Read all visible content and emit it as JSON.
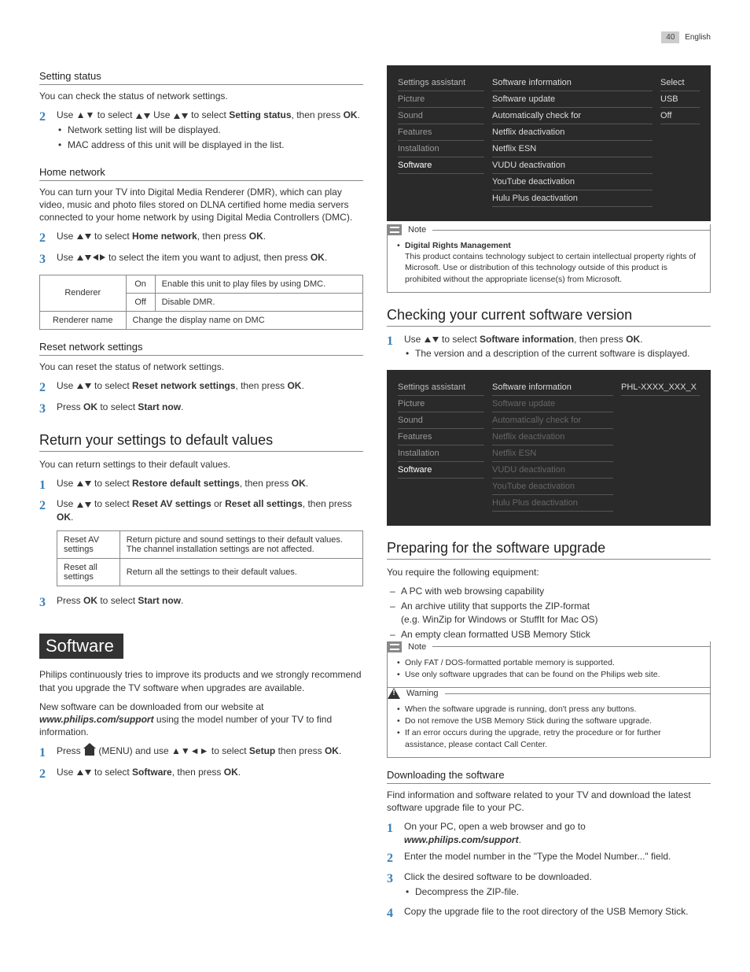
{
  "page": {
    "number": "40",
    "lang": "English"
  },
  "col_left": {
    "setting_status": {
      "h": "Setting status",
      "p": "You can check the status of network settings.",
      "step2": "Use ▲▼ to select ",
      "step2_bold": "Setting status",
      "step2_tail": ", then press ",
      "ok": "OK",
      "step2_end": ".",
      "bul1": "Network setting list will be displayed.",
      "bul2": "MAC address of this unit will be displayed in the list."
    },
    "home_network": {
      "h": "Home network",
      "p": "You can turn your TV into Digital Media Renderer (DMR), which can play video, music and photo files stored on DLNA certified home media servers connected to your home network by using Digital Media Controllers (DMC).",
      "s2a": "Use ▲▼ to select ",
      "s2b": "Home network",
      "s2c": ", then press ",
      "s3a": "Use ▲▼◄► to select the item you want to adjust, then press ",
      "table": {
        "r1c1": "Renderer",
        "r1c2": "On",
        "r1c3": "Enable this unit to play files by using DMC.",
        "r2c2": "Off",
        "r2c3": "Disable DMR.",
        "r3c1": "Renderer name",
        "r3c2": "Change the display name on DMC"
      }
    },
    "reset_net": {
      "h": "Reset network settings",
      "p": "You can reset the status of network settings.",
      "s2a": "Use ▲▼ to select ",
      "s2b": "Reset network settings",
      "s2c": ", then press ",
      "s3a": "Press ",
      "s3b": " to select ",
      "s3c": "Start now",
      "s3d": "."
    },
    "return_default": {
      "h": "Return your settings to default values",
      "p": "You can return settings to their default values.",
      "s1a": "Use ▲▼ to select ",
      "s1b": "Restore default settings",
      "s1c": ", then press ",
      "s2a": "Use ▲▼ to select ",
      "s2b": "Reset AV settings",
      "s2c": " or ",
      "s2d": "Reset all settings",
      "s2e": ", then press ",
      "table": {
        "r1c1": "Reset AV settings",
        "r1c2": "Return picture and sound settings to their default values. The channel installation settings are not affected.",
        "r2c1": "Reset all settings",
        "r2c2": "Return all the settings to their default values."
      },
      "s3a": "Press ",
      "s3b": " to select ",
      "s3c": "Start now",
      "s3d": "."
    },
    "software": {
      "h": "Software",
      "p1": "Philips continuously tries to improve its products and we strongly recommend that you upgrade the TV software when upgrades are available.",
      "p2a": "New software can be downloaded from our website at ",
      "p2b": "www.philips.com/support",
      "p2c": " using the model number of your TV to find information.",
      "s1a": "Press ",
      "s1b": " (MENU) and use ▲▼◄► to select ",
      "s1c": "Setup",
      "s1d": " then press ",
      "s2a": "Use ▲▼ to select ",
      "s2b": "Software",
      "s2c": ", then press "
    }
  },
  "col_right": {
    "ui1": {
      "c1": [
        "Settings assistant",
        "Picture",
        "Sound",
        "Features",
        "Installation",
        "Software"
      ],
      "c2": [
        "Software information",
        "Software update",
        "Automatically check for",
        "Netflix deactivation",
        "Netflix ESN",
        "VUDU deactivation",
        "YouTube deactivation",
        "Hulu Plus deactivation"
      ],
      "c3": [
        "Select",
        "USB",
        "Off"
      ]
    },
    "note1": {
      "title": "Note",
      "b1": "Digital Rights Management",
      "b2": "This product contains technology subject to certain intellectual property rights of Microsoft. Use or distribution of this technology outside of this product is prohibited without the appropriate license(s) from Microsoft."
    },
    "check_sw": {
      "h": "Checking your current software version",
      "s1a": "Use ▲▼ to select ",
      "s1b": "Software information",
      "s1c": ", then press ",
      "bul": "The version and a description of the current software is displayed."
    },
    "ui2": {
      "c1": [
        "Settings assistant",
        "Picture",
        "Sound",
        "Features",
        "Installation",
        "Software"
      ],
      "c2": [
        "Software information",
        "Software update",
        "Automatically check for",
        "Netflix deactivation",
        "Netflix ESN",
        "VUDU deactivation",
        "YouTube deactivation",
        "Hulu Plus deactivation"
      ],
      "c3": [
        "PHL-XXXX_XXX_X"
      ]
    },
    "prep": {
      "h": "Preparing for the software upgrade",
      "p": "You require the following equipment:",
      "d1": "A PC with web browsing capability",
      "d2": "An archive utility that supports the ZIP-format",
      "d2b": "(e.g. WinZip for Windows or StuffIt for Mac OS)",
      "d3": "An empty clean formatted USB Memory Stick"
    },
    "note2": {
      "title": "Note",
      "l1": "Only FAT / DOS-formatted portable memory is supported.",
      "l2": "Use only software upgrades that can be found on the Philips web site."
    },
    "warn": {
      "title": "Warning",
      "l1": "When the software upgrade is running, don't press any buttons.",
      "l2": "Do not remove the USB Memory Stick during the software upgrade.",
      "l3": "If an error occurs during the upgrade, retry the procedure or for further assistance, please contact Call Center."
    },
    "download": {
      "h": "Downloading the software",
      "p": "Find information and software related to your TV and download the latest software upgrade file to your PC.",
      "s1a": "On your PC, open a web browser and go to",
      "s1b": "www.philips.com/support",
      "s1c": ".",
      "s2": "Enter the model number in the \"Type the Model Number...\" field.",
      "s3": "Click the desired software to be downloaded.",
      "s3b": "Decompress the ZIP-file.",
      "s4": "Copy the upgrade file to the root directory of the USB Memory Stick."
    },
    "ok": "OK"
  }
}
